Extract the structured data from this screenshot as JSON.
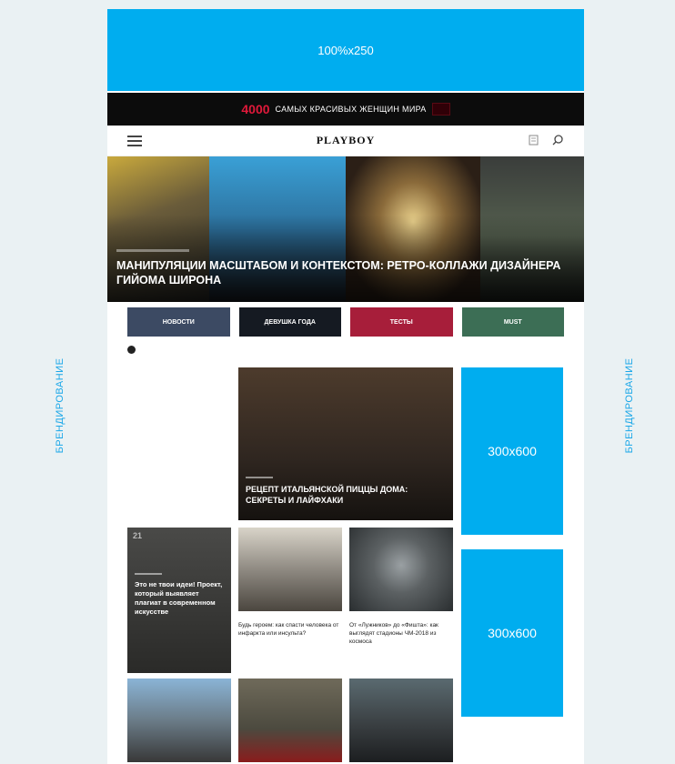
{
  "branding": {
    "left": "БРЕНДИРОВАНИЕ",
    "right": "БРЕНДИРОВАНИЕ"
  },
  "ad_top": "100%x250",
  "promo": {
    "number": "4000",
    "text": "САМЫХ КРАСИВЫХ ЖЕНЩИН МИРА"
  },
  "header": {
    "logo": "PLAYBOY"
  },
  "hero": {
    "title": "МАНИПУЛЯЦИИ МАСШТАБОМ И КОНТЕКСТОМ: РЕТРО-КОЛЛАЖИ ДИЗАЙНЕРА ГИЙОМА ШИРОНА"
  },
  "categories": [
    {
      "label": "НОВОСТИ",
      "color": "#3c4a63"
    },
    {
      "label": "ДЕВУШКА ГОДА",
      "color": "#151a22"
    },
    {
      "label": "ТЕСТЫ",
      "color": "#a71e3a"
    },
    {
      "label": "MUST",
      "color": "#3c6e55"
    }
  ],
  "feature": {
    "title": "РЕЦЕПТ ИТАЛЬЯНСКОЙ ПИЦЦЫ ДОМА: СЕКРЕТЫ И ЛАЙФХАКИ"
  },
  "ads": {
    "box1": "300x600",
    "box2": "300x600"
  },
  "dark_card": {
    "date": "21",
    "title": "Это не твои идеи! Проект, который выявляет плагиат в современном искусстве"
  },
  "cards": [
    {
      "title": "Будь героем: как спасти человека от инфаркта или инсульта?"
    },
    {
      "title": "От «Лужников» до «Фишта»: как выглядят стадионы ЧМ-2018 из космоса"
    }
  ],
  "colors": {
    "ad_blue": "#00adef",
    "accent_red": "#e0193a"
  }
}
